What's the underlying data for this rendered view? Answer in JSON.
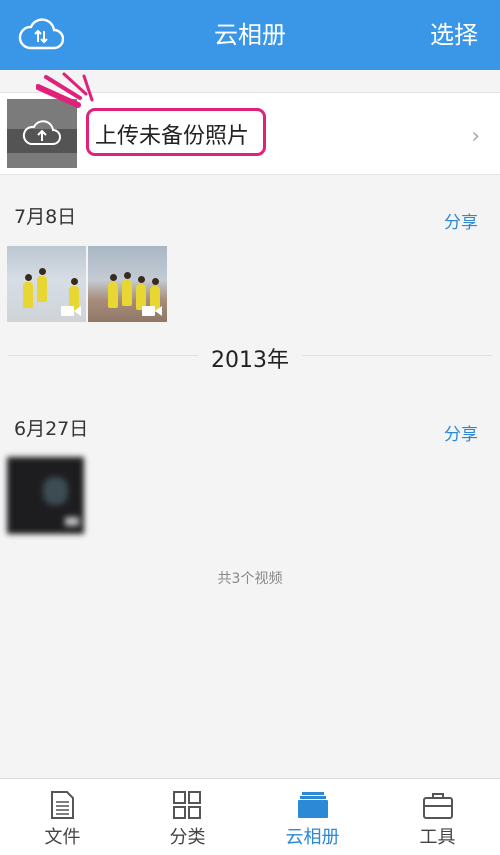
{
  "header": {
    "title": "云相册",
    "select_label": "选择",
    "cloud_icon": "cloud-sync-icon"
  },
  "upload": {
    "label": "上传未备份照片",
    "chevron": "›"
  },
  "groups": [
    {
      "date": "7月8日",
      "share": "分享"
    },
    {
      "date": "6月27日",
      "share": "分享"
    }
  ],
  "year_divider": "2013年",
  "summary": "共3个视频",
  "tabs": [
    {
      "label": "文件",
      "icon": "document-icon"
    },
    {
      "label": "分类",
      "icon": "grid-icon"
    },
    {
      "label": "云相册",
      "icon": "album-icon",
      "active": true
    },
    {
      "label": "工具",
      "icon": "toolbox-icon"
    }
  ],
  "colors": {
    "header": "#3a97e8",
    "accent": "#2b89d6",
    "highlight": "#e0217a"
  }
}
